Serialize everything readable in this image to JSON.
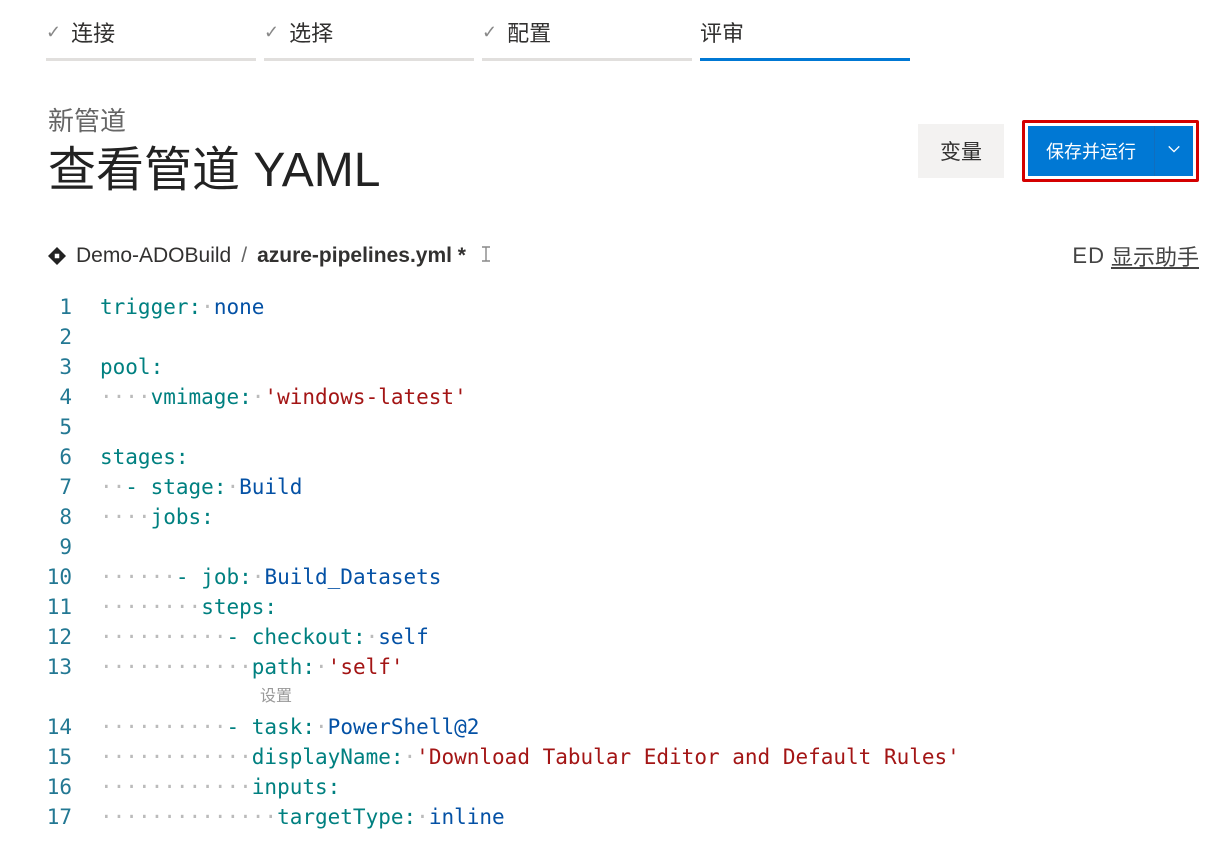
{
  "stepper": {
    "steps": [
      {
        "label": "连接",
        "done": true,
        "active": false
      },
      {
        "label": "选择",
        "done": true,
        "active": false
      },
      {
        "label": "配置",
        "done": true,
        "active": false
      },
      {
        "label": "评审",
        "done": false,
        "active": true
      }
    ]
  },
  "header": {
    "subtitle": "新管道",
    "title": "查看管道 YAML",
    "variables_label": "变量",
    "save_run_label": "保存并运行"
  },
  "breadcrumb": {
    "repo": "Demo-ADOBuild",
    "separator": "/",
    "file": "azure-pipelines.yml *"
  },
  "assistant": {
    "prefix": "ED",
    "label": "显示助手"
  },
  "code": {
    "settings_label": "设置",
    "lines": [
      {
        "n": 1,
        "segs": [
          {
            "t": "key",
            "v": "trigger"
          },
          {
            "t": "punct",
            "v": ":"
          },
          {
            "t": "sp",
            "v": " "
          },
          {
            "t": "val",
            "v": "none"
          }
        ]
      },
      {
        "n": 2,
        "segs": []
      },
      {
        "n": 3,
        "segs": [
          {
            "t": "key",
            "v": "pool"
          },
          {
            "t": "punct",
            "v": ":"
          }
        ]
      },
      {
        "n": 4,
        "segs": [
          {
            "t": "indent",
            "v": 1
          },
          {
            "t": "key",
            "v": "vmimage"
          },
          {
            "t": "punct",
            "v": ":"
          },
          {
            "t": "sp",
            "v": " "
          },
          {
            "t": "str",
            "v": "'windows-latest'"
          }
        ]
      },
      {
        "n": 5,
        "segs": []
      },
      {
        "n": 6,
        "segs": [
          {
            "t": "key",
            "v": "stages"
          },
          {
            "t": "punct",
            "v": ":"
          }
        ]
      },
      {
        "n": 7,
        "segs": [
          {
            "t": "indent",
            "v": 0
          },
          {
            "t": "punct",
            "v": "- "
          },
          {
            "t": "key",
            "v": "stage"
          },
          {
            "t": "punct",
            "v": ":"
          },
          {
            "t": "sp",
            "v": " "
          },
          {
            "t": "val",
            "v": "Build"
          }
        ]
      },
      {
        "n": 8,
        "segs": [
          {
            "t": "indent",
            "v": 1
          },
          {
            "t": "key",
            "v": "jobs"
          },
          {
            "t": "punct",
            "v": ":"
          }
        ]
      },
      {
        "n": 9,
        "segs": []
      },
      {
        "n": 10,
        "segs": [
          {
            "t": "indent",
            "v": 2
          },
          {
            "t": "punct",
            "v": "- "
          },
          {
            "t": "key",
            "v": "job"
          },
          {
            "t": "punct",
            "v": ":"
          },
          {
            "t": "sp",
            "v": " "
          },
          {
            "t": "val",
            "v": "Build_Datasets"
          }
        ]
      },
      {
        "n": 11,
        "segs": [
          {
            "t": "indent",
            "v": 3
          },
          {
            "t": "key",
            "v": "steps"
          },
          {
            "t": "punct",
            "v": ":"
          }
        ]
      },
      {
        "n": 12,
        "segs": [
          {
            "t": "indent",
            "v": 4
          },
          {
            "t": "punct",
            "v": "- "
          },
          {
            "t": "key",
            "v": "checkout"
          },
          {
            "t": "punct",
            "v": ":"
          },
          {
            "t": "sp",
            "v": " "
          },
          {
            "t": "val",
            "v": "self"
          }
        ]
      },
      {
        "n": 13,
        "segs": [
          {
            "t": "indent",
            "v": 5
          },
          {
            "t": "key",
            "v": "path"
          },
          {
            "t": "punct",
            "v": ":"
          },
          {
            "t": "sp",
            "v": " "
          },
          {
            "t": "str",
            "v": "'self'"
          }
        ]
      },
      {
        "n": 14,
        "segs": [
          {
            "t": "indent",
            "v": 4
          },
          {
            "t": "punct",
            "v": "- "
          },
          {
            "t": "key",
            "v": "task"
          },
          {
            "t": "punct",
            "v": ":"
          },
          {
            "t": "sp",
            "v": " "
          },
          {
            "t": "val",
            "v": "PowerShell@2"
          }
        ],
        "before_codelens": true
      },
      {
        "n": 15,
        "segs": [
          {
            "t": "indent",
            "v": 5
          },
          {
            "t": "key",
            "v": "displayName"
          },
          {
            "t": "punct",
            "v": ":"
          },
          {
            "t": "sp",
            "v": " "
          },
          {
            "t": "str",
            "v": "'Download Tabular Editor and Default Rules'"
          }
        ]
      },
      {
        "n": 16,
        "segs": [
          {
            "t": "indent",
            "v": 5
          },
          {
            "t": "key",
            "v": "inputs"
          },
          {
            "t": "punct",
            "v": ":"
          }
        ]
      },
      {
        "n": 17,
        "segs": [
          {
            "t": "indent",
            "v": 6
          },
          {
            "t": "key",
            "v": "targetType"
          },
          {
            "t": "punct",
            "v": ":"
          },
          {
            "t": "sp",
            "v": " "
          },
          {
            "t": "val",
            "v": "inline"
          }
        ]
      }
    ]
  }
}
